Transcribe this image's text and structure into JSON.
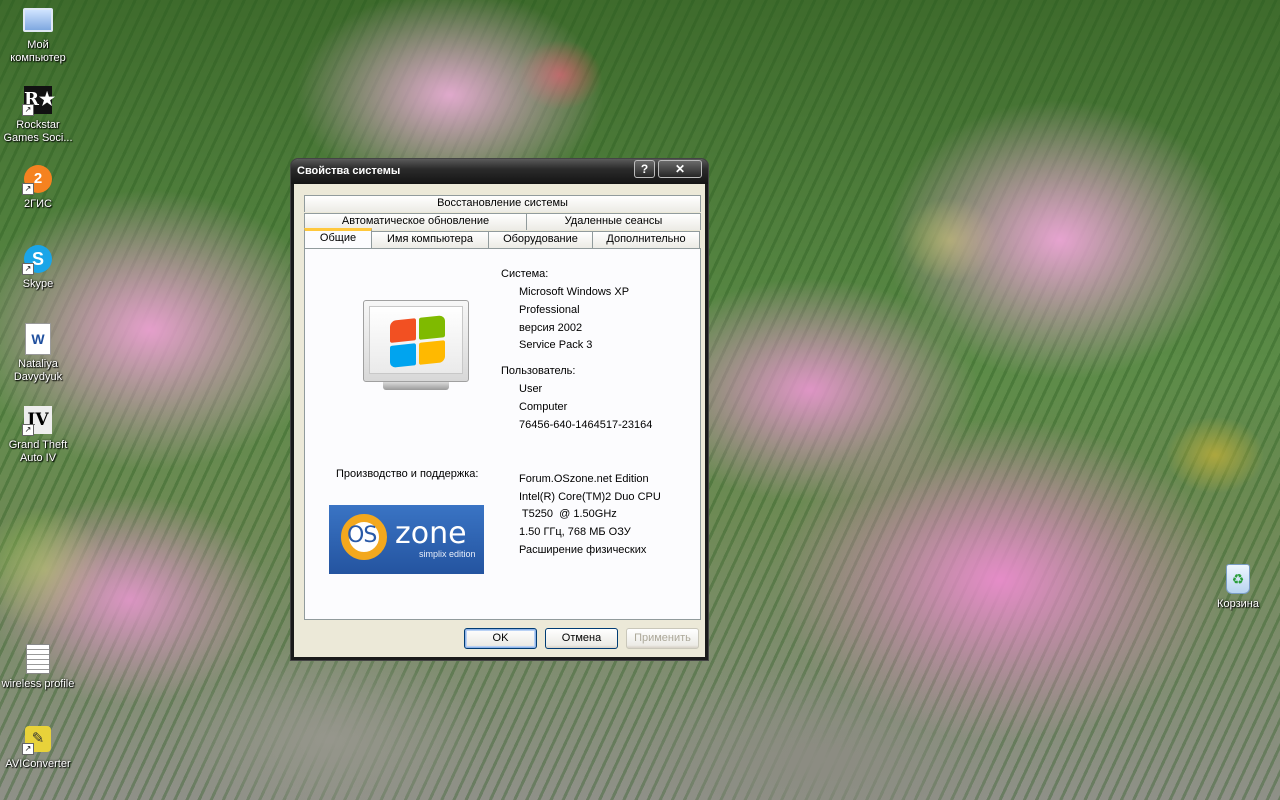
{
  "desktop": {
    "icons": [
      {
        "label": "Мой компьютер",
        "icon": "my-computer-icon"
      },
      {
        "label": "Rockstar Games Soci...",
        "icon": "rockstar-icon",
        "glyph": "R★"
      },
      {
        "label": "2ГИС",
        "icon": "2gis-icon",
        "glyph": "2"
      },
      {
        "label": "Skype",
        "icon": "skype-icon",
        "glyph": "S"
      },
      {
        "label": "Nataliya Davydyuk",
        "icon": "word-document-icon",
        "glyph": "W"
      },
      {
        "label": "Grand Theft Auto IV",
        "icon": "gta-iv-icon",
        "glyph": "IV"
      },
      {
        "label": "wireless profile",
        "icon": "text-file-icon"
      },
      {
        "label": "AVIConverter",
        "icon": "aviconverter-icon",
        "glyph": "✎"
      },
      {
        "label": "Корзина",
        "icon": "recycle-bin-icon",
        "glyph": "♻"
      }
    ]
  },
  "dialog": {
    "title": "Свойства системы",
    "help_glyph": "?",
    "close_glyph": "✕",
    "tabs_row1": [
      "Восстановление системы"
    ],
    "tabs_row2": [
      "Автоматическое обновление",
      "Удаленные сеансы"
    ],
    "tabs_row3": [
      "Общие",
      "Имя компьютера",
      "Оборудование",
      "Дополнительно"
    ],
    "active_tab": "Общие",
    "system": {
      "heading": "Система:",
      "lines": [
        "Microsoft Windows XP",
        "Professional",
        "версия 2002",
        "Service Pack 3"
      ]
    },
    "user": {
      "heading": "Пользователь:",
      "lines": [
        "User",
        "Computer",
        "76456-640-1464517-23164"
      ]
    },
    "support": {
      "heading": "Производство и поддержка:",
      "logo": {
        "os": "OS",
        "zone": "zone",
        "edition": "simplix edition"
      }
    },
    "computer": {
      "lines": [
        "Forum.OSzone.net Edition",
        "Intel(R) Core(TM)2 Duo CPU",
        " T5250  @ 1.50GHz",
        "1.50 ГГц, 768 МБ ОЗУ",
        "Расширение физических"
      ]
    },
    "buttons": {
      "ok": "OK",
      "cancel": "Отмена",
      "apply": "Применить"
    }
  }
}
